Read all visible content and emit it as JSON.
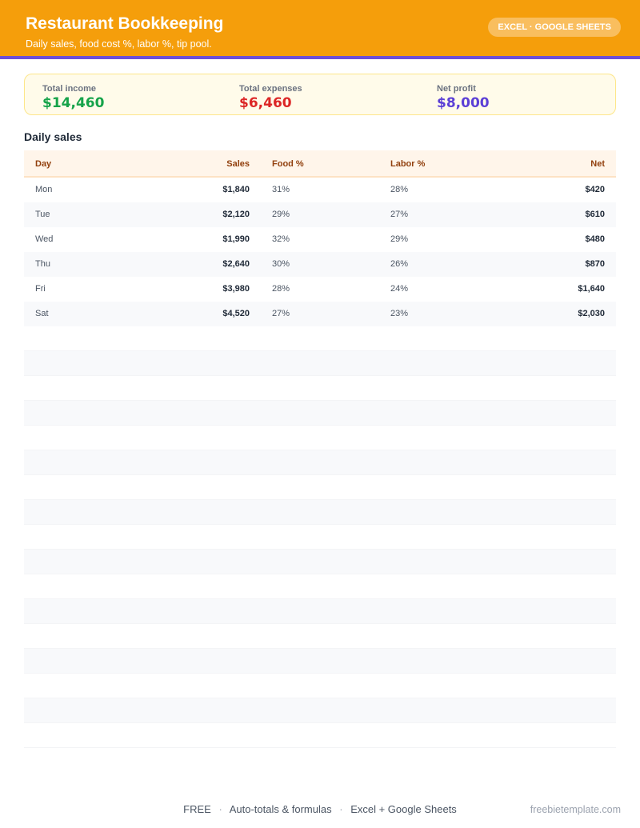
{
  "header": {
    "title": "Restaurant Bookkeeping",
    "subtitle": "Daily sales, food cost %, labor %, tip pool.",
    "badge": "EXCEL · GOOGLE SHEETS",
    "accent_color": "#f59e0b",
    "strip_color": "#6d4fd8"
  },
  "summary": {
    "income": {
      "label": "Total income",
      "value": "$14,460",
      "color": "#16a34a"
    },
    "expenses": {
      "label": "Total expenses",
      "value": "$6,460",
      "color": "#dc2626"
    },
    "profit": {
      "label": "Net profit",
      "value": "$8,000",
      "color": "#5b3fd6"
    }
  },
  "section": {
    "title": "Daily sales"
  },
  "table": {
    "headers": {
      "day": "Day",
      "sales": "Sales",
      "food": "Food %",
      "labor": "Labor %",
      "net": "Net"
    },
    "rows": [
      {
        "day": "Mon",
        "sales": "$1,840",
        "food": "31%",
        "labor": "28%",
        "net": "$420"
      },
      {
        "day": "Tue",
        "sales": "$2,120",
        "food": "29%",
        "labor": "27%",
        "net": "$610"
      },
      {
        "day": "Wed",
        "sales": "$1,990",
        "food": "32%",
        "labor": "29%",
        "net": "$480"
      },
      {
        "day": "Thu",
        "sales": "$2,640",
        "food": "30%",
        "labor": "26%",
        "net": "$870"
      },
      {
        "day": "Fri",
        "sales": "$3,980",
        "food": "28%",
        "labor": "24%",
        "net": "$1,640"
      },
      {
        "day": "Sat",
        "sales": "$4,520",
        "food": "27%",
        "labor": "23%",
        "net": "$2,030"
      }
    ]
  },
  "footer": {
    "item1": "FREE",
    "item2": "Auto-totals & formulas",
    "item3": "Excel + Google Sheets",
    "separator": "·",
    "site": "freebietemplate.com"
  }
}
